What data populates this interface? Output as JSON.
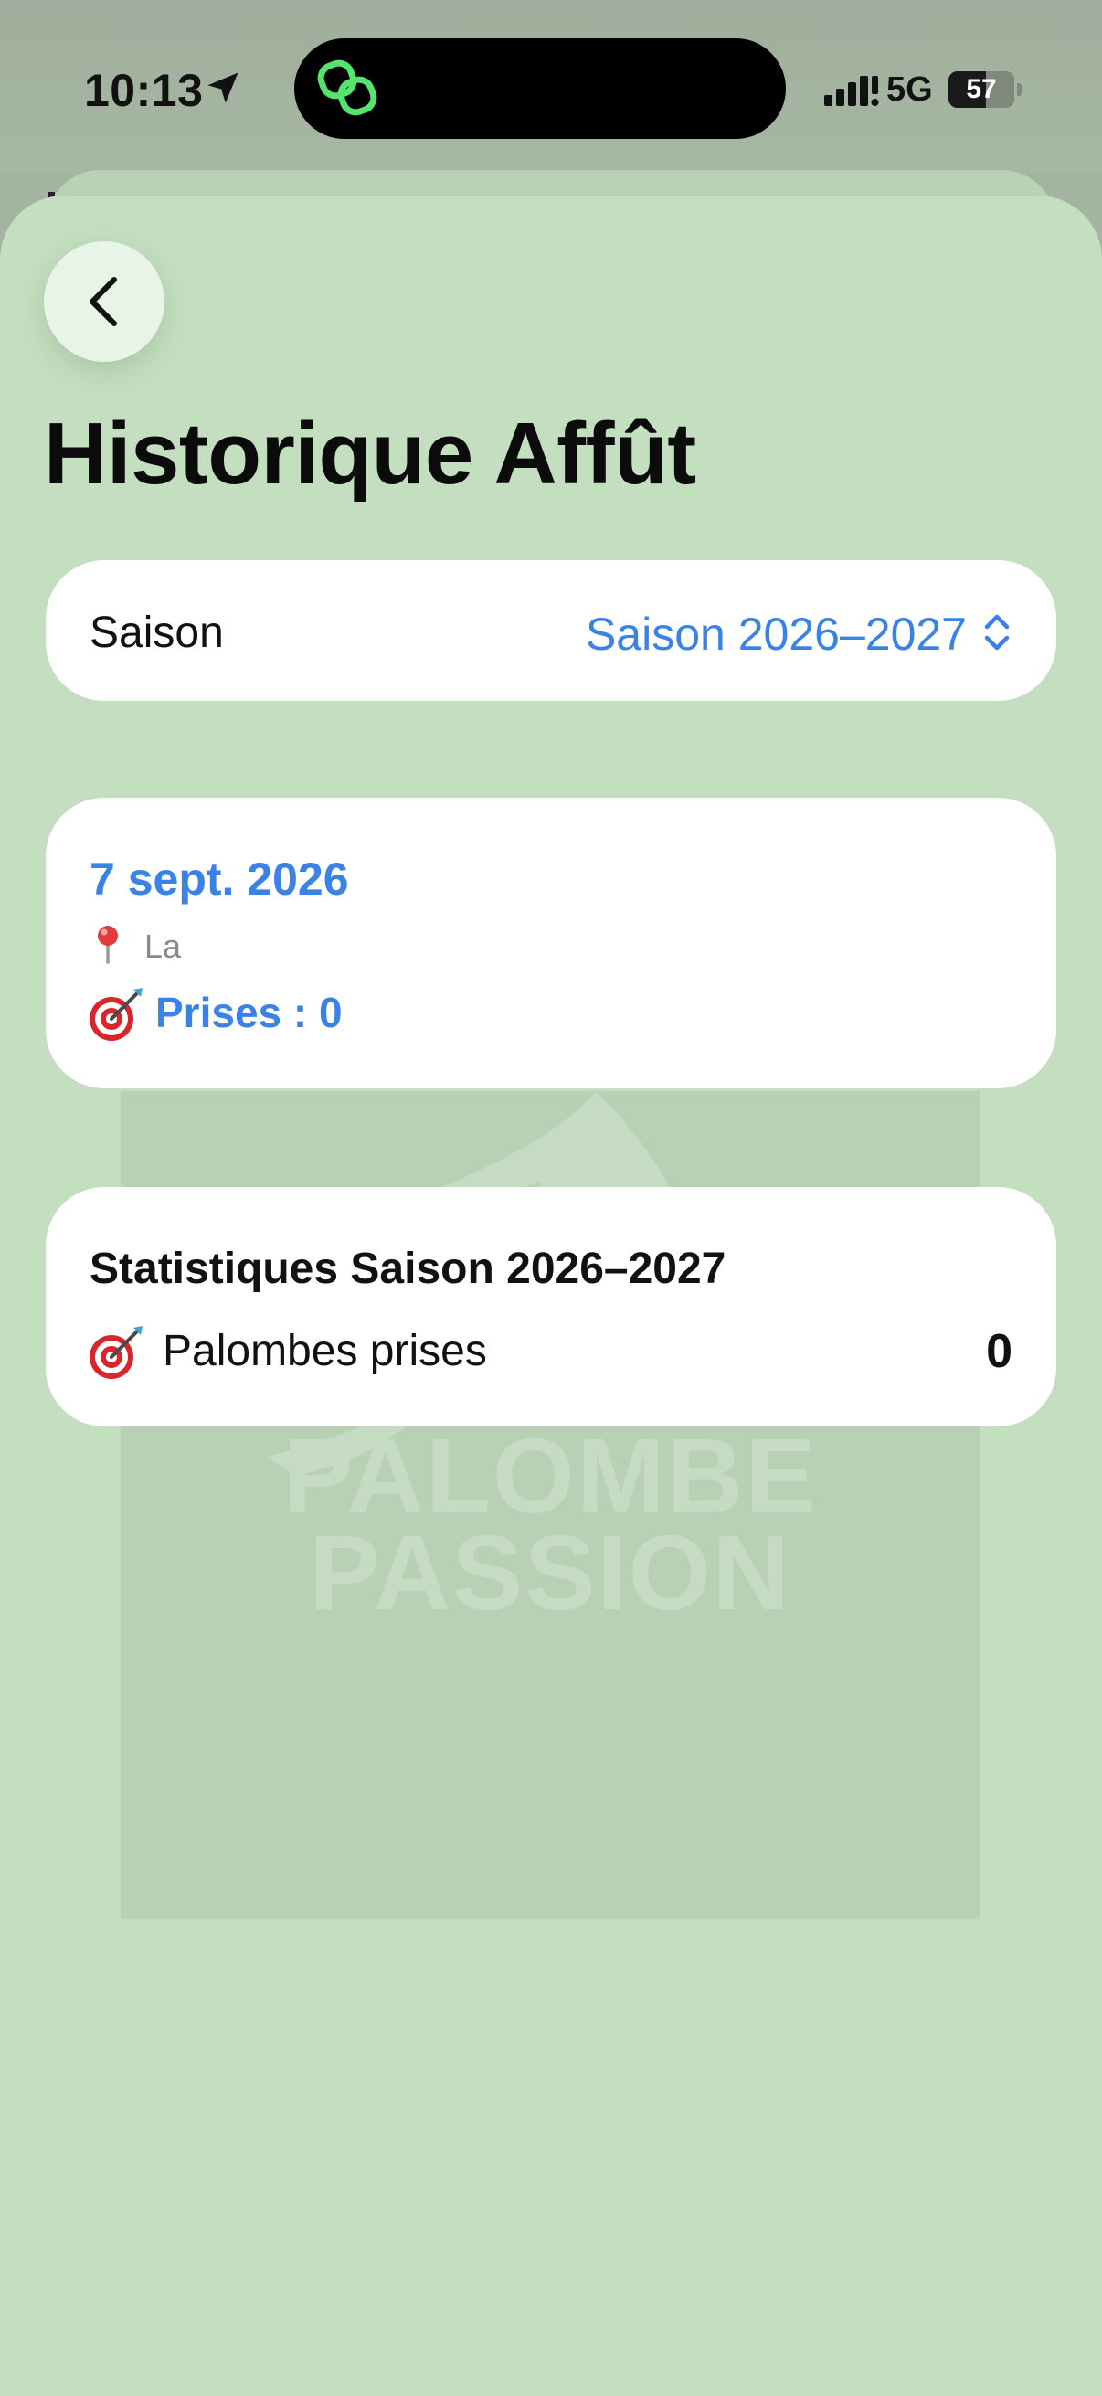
{
  "status_bar": {
    "time": "10:13",
    "network": "5G",
    "battery_percent": "57",
    "battery_level": 0.57
  },
  "header": {
    "title": "Historique Affût",
    "back_icon": "chevron-left-icon"
  },
  "season_picker": {
    "label": "Saison",
    "value": "Saison 2026–2027",
    "icon": "chevron-updown-icon"
  },
  "sessions": [
    {
      "date": "7 sept. 2026",
      "location": "La",
      "location_icon": "pin-icon",
      "catches": "Prises : 0",
      "catches_icon": "target-icon"
    }
  ],
  "stats": {
    "title": "Statistiques Saison 2026–2027",
    "rows": [
      {
        "label": "Palombes prises",
        "value": "0",
        "icon": "target-icon"
      }
    ]
  },
  "watermark": {
    "line1": "PALOMBE",
    "line2": "PASSION"
  },
  "colors": {
    "sheet_background": "#c3dfc0",
    "accent": "#3b82e6",
    "card": "#ffffff"
  }
}
